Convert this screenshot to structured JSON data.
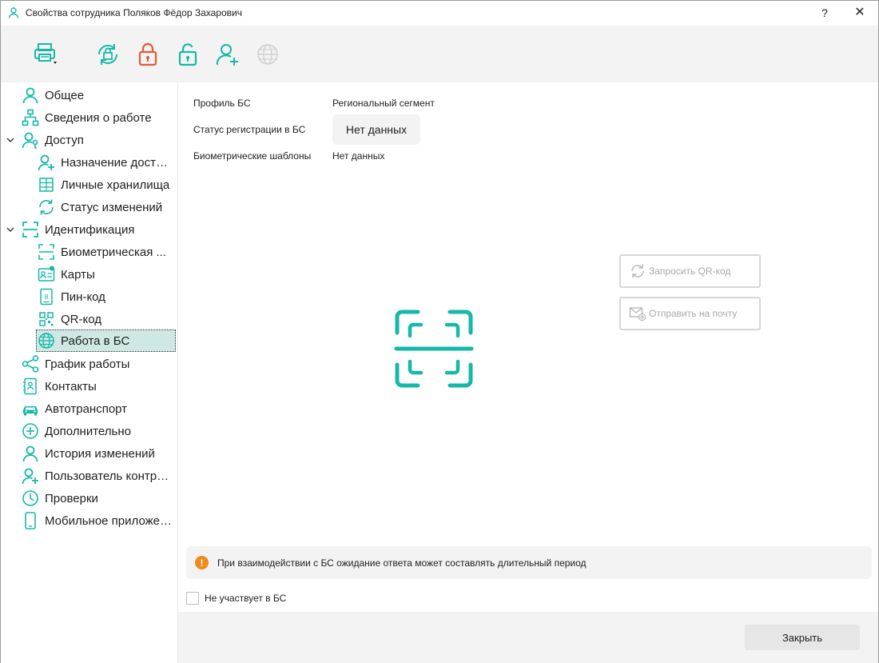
{
  "window": {
    "title": "Свойства сотрудника Поляков Фёдор Захарович",
    "help_label": "?",
    "close_label": "✕"
  },
  "toolbar": {
    "buttons": [
      {
        "icon": "printer-icon",
        "enabled": true
      },
      {
        "icon": "sync-lock-icon",
        "enabled": true
      },
      {
        "icon": "lock-closed-icon",
        "enabled": true
      },
      {
        "icon": "lock-open-icon",
        "enabled": true
      },
      {
        "icon": "add-user-icon",
        "enabled": true
      },
      {
        "icon": "globe-icon",
        "enabled": false
      }
    ]
  },
  "sidebar": {
    "items": [
      {
        "label": "Общее",
        "icon": "user-icon",
        "level": 0
      },
      {
        "label": "Сведения о работе",
        "icon": "org-chart-icon",
        "level": 0
      },
      {
        "label": "Доступ",
        "icon": "user-key-icon",
        "level": 0,
        "expanded": true
      },
      {
        "label": "Назначение доступа",
        "icon": "user-add-icon",
        "level": 1
      },
      {
        "label": "Личные хранилища",
        "icon": "locker-icon",
        "level": 1
      },
      {
        "label": "Статус изменений",
        "icon": "refresh-icon",
        "level": 1
      },
      {
        "label": "Идентификация",
        "icon": "scan-icon",
        "level": 0,
        "expanded": true
      },
      {
        "label": "Биометрическая ...",
        "icon": "scan-face-icon",
        "level": 1
      },
      {
        "label": "Карты",
        "icon": "id-card-icon",
        "level": 1
      },
      {
        "label": "Пин-код",
        "icon": "keypad-icon",
        "level": 1
      },
      {
        "label": "QR-код",
        "icon": "qr-code-icon",
        "level": 1
      },
      {
        "label": "Работа в БС",
        "icon": "globe-icon",
        "level": 1,
        "selected": true
      },
      {
        "label": "График работы",
        "icon": "share-icon",
        "level": 0
      },
      {
        "label": "Контакты",
        "icon": "contacts-icon",
        "level": 0
      },
      {
        "label": "Автотранспорт",
        "icon": "car-icon",
        "level": 0
      },
      {
        "label": "Дополнительно",
        "icon": "plus-circle-icon",
        "level": 0
      },
      {
        "label": "История изменений",
        "icon": "user-history-icon",
        "level": 0
      },
      {
        "label": "Пользователь контроллера",
        "icon": "user-plus-icon",
        "level": 0
      },
      {
        "label": "Проверки",
        "icon": "clock-icon",
        "level": 0
      },
      {
        "label": "Мобильное приложение",
        "icon": "phone-icon",
        "level": 0
      }
    ]
  },
  "main": {
    "profile_label": "Профиль БС",
    "profile_value": "Региональный сегмент",
    "status_label": "Статус регистрации в БС",
    "status_value": "Нет данных",
    "templates_label": "Биометрические шаблоны",
    "templates_value": "Нет данных",
    "request_qr_label": "Запросить QR-код",
    "send_mail_label": "Отправить на почту",
    "info_text": "При взаимодействии с БС ожидание ответа может составлять длительный период",
    "info_icon": "!",
    "not_participating_label": "Не участвует в БС",
    "not_participating_checked": false
  },
  "footer": {
    "close_label": "Закрыть"
  },
  "colors": {
    "accent": "#16b8a8",
    "lock_red": "#e25a3c",
    "warning": "#f08a1c",
    "selected_bg": "#cfe8e5",
    "disabled": "#a8a8a8"
  }
}
